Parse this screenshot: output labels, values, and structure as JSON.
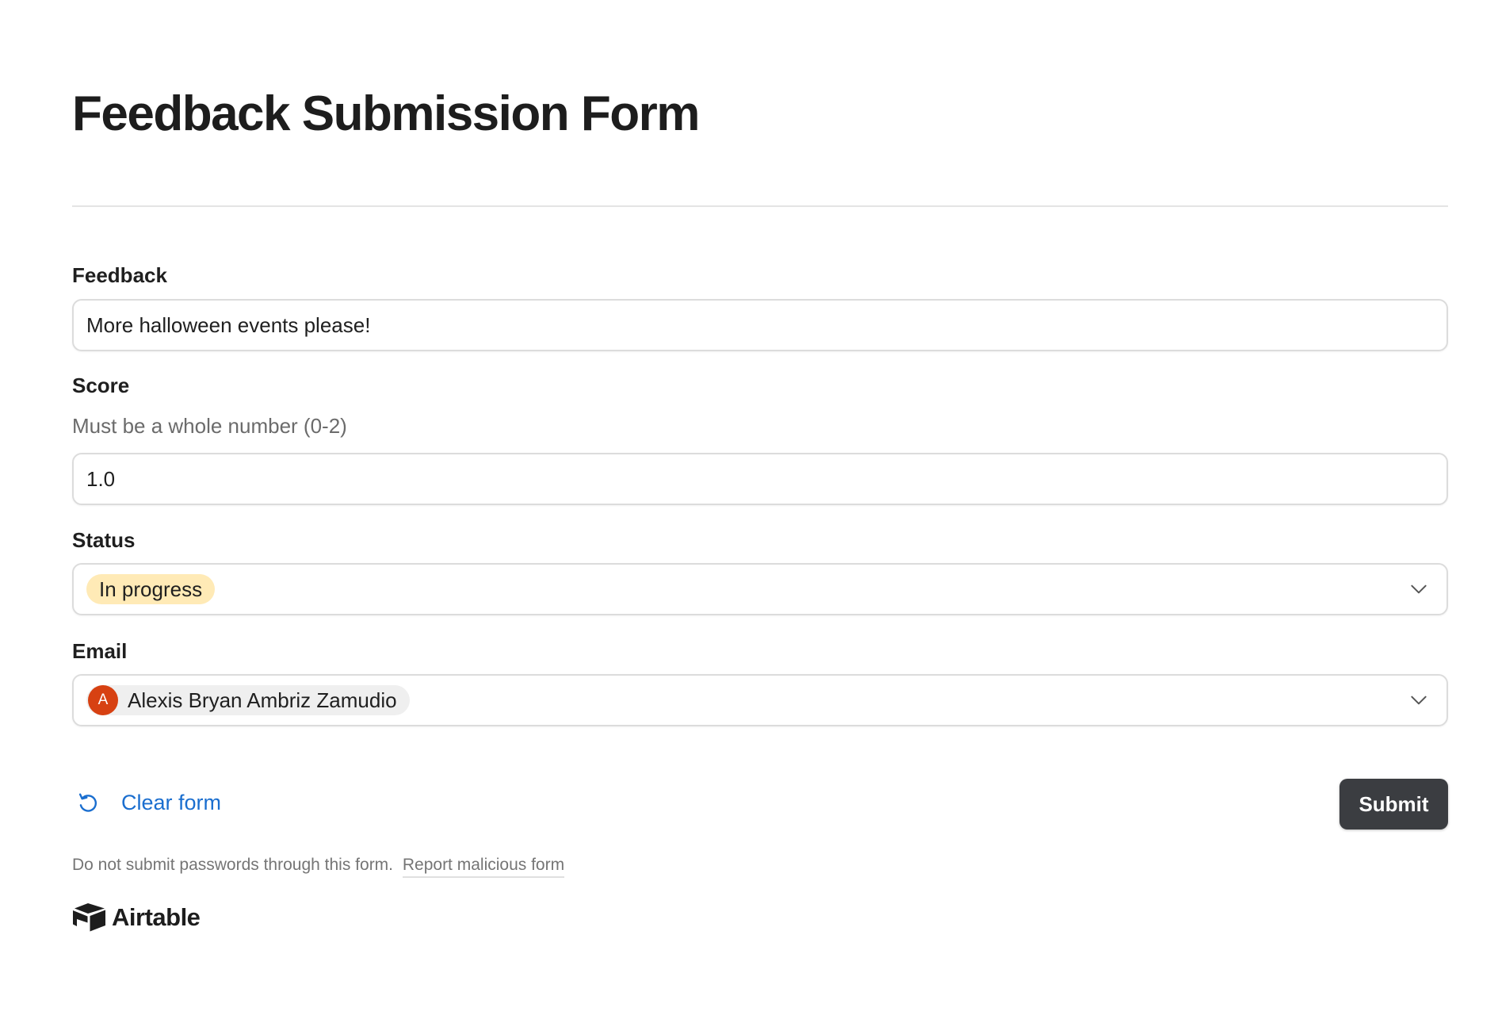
{
  "form": {
    "title": "Feedback Submission Form"
  },
  "fields": {
    "feedback": {
      "label": "Feedback",
      "value": "More halloween events please!"
    },
    "score": {
      "label": "Score",
      "help": "Must be a whole number (0-2)",
      "value": "1.0"
    },
    "status": {
      "label": "Status",
      "value": "In progress",
      "pill_color": "#ffeab6"
    },
    "email": {
      "label": "Email",
      "avatar_initial": "A",
      "avatar_color": "#d74112",
      "value": "Alexis Bryan Ambriz Zamudio"
    }
  },
  "actions": {
    "clear_label": "Clear form",
    "submit_label": "Submit",
    "clear_icon": "undo-icon",
    "dropdown_icon": "chevron-down-icon"
  },
  "footer": {
    "note": "Do not submit passwords through this form.",
    "report_link": "Report malicious form",
    "brand": "Airtable",
    "brand_icon": "airtable-logo-icon"
  },
  "colors": {
    "link": "#1a6ecf",
    "submit_bg": "#3b3d41"
  }
}
